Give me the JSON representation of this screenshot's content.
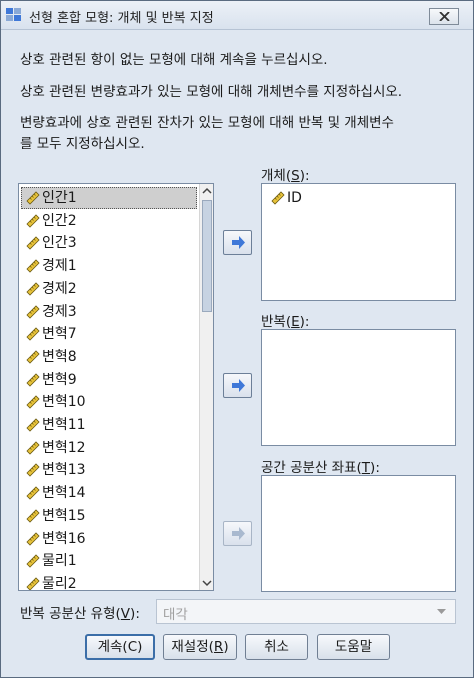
{
  "window": {
    "title": "선형 혼합 모형: 개체 및 반복 지정"
  },
  "instructions": [
    "상호 관련된 항이 없는 모형에 대해 계속을 누르십시오.",
    "상호 관련된 변량효과가 있는 모형에 대해 개체변수를 지정하십시오.",
    "변량효과에 상호 관련된 잔차가 있는 모형에 대해 반복 및 개체변수",
    "를 모두 지정하십시오."
  ],
  "variables": [
    {
      "label": "인간1",
      "icon": "scale-ruler-icon",
      "selected": true
    },
    {
      "label": "인간2",
      "icon": "scale-ruler-icon"
    },
    {
      "label": "인간3",
      "icon": "scale-ruler-icon"
    },
    {
      "label": "경제1",
      "icon": "scale-ruler-icon"
    },
    {
      "label": "경제2",
      "icon": "scale-ruler-icon"
    },
    {
      "label": "경제3",
      "icon": "scale-ruler-icon"
    },
    {
      "label": "변혁7",
      "icon": "scale-ruler-icon"
    },
    {
      "label": "변혁8",
      "icon": "scale-ruler-icon"
    },
    {
      "label": "변혁9",
      "icon": "scale-ruler-icon"
    },
    {
      "label": "변혁10",
      "icon": "scale-ruler-icon"
    },
    {
      "label": "변혁11",
      "icon": "scale-ruler-icon"
    },
    {
      "label": "변혁12",
      "icon": "scale-ruler-icon"
    },
    {
      "label": "변혁13",
      "icon": "scale-ruler-icon"
    },
    {
      "label": "변혁14",
      "icon": "scale-ruler-icon"
    },
    {
      "label": "변혁15",
      "icon": "scale-ruler-icon"
    },
    {
      "label": "변혁16",
      "icon": "scale-ruler-icon"
    },
    {
      "label": "물리1",
      "icon": "scale-ruler-icon"
    },
    {
      "label": "물리2",
      "icon": "scale-ruler-icon"
    }
  ],
  "subjects": {
    "label_pre": "개체(",
    "mnemonic": "S",
    "label_post": "):",
    "items": [
      {
        "label": "ID",
        "icon": "scale-ruler-icon"
      }
    ]
  },
  "repeated": {
    "label_pre": "반복(",
    "mnemonic": "E",
    "label_post": "):"
  },
  "spatial": {
    "label_pre": "공간 공분산 좌표(",
    "mnemonic": "T",
    "label_post": "):"
  },
  "covariance": {
    "label_pre": "반복 공분산 유형(",
    "mnemonic": "V",
    "label_post": "):",
    "value": "대각",
    "enabled": false
  },
  "buttons": {
    "continue": "계속(C)",
    "reset_pre": "재설정(",
    "reset_mnemonic": "R",
    "reset_post": ")",
    "cancel": "취소",
    "help": "도움말"
  },
  "colors": {
    "dialog_bg": "#dfe7f1",
    "arrow_blue": "#3f78d8",
    "arrow_disabled": "#a9b9cf",
    "ruler_yellow": "#e8c33a"
  }
}
